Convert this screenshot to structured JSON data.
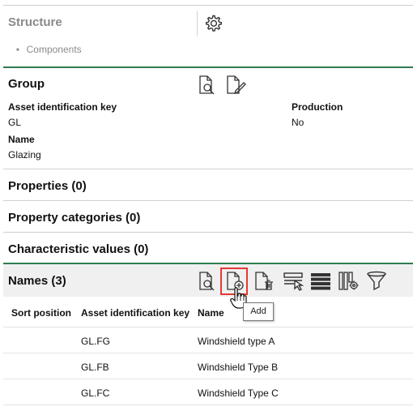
{
  "structure": {
    "title": "Structure",
    "settings_icon": "gear-icon",
    "items": [
      "Components"
    ]
  },
  "group": {
    "title": "Group",
    "icons": [
      "document-preview-icon",
      "document-edit-icon"
    ],
    "asset_key_label": "Asset identification key",
    "asset_key_value": "GL",
    "production_label": "Production",
    "production_value": "No",
    "name_label": "Name",
    "name_value": "Glazing"
  },
  "sections": {
    "properties": "Properties (0)",
    "property_categories": "Property categories (0)",
    "characteristic_values": "Characteristic values (0)"
  },
  "names": {
    "title": "Names (3)",
    "toolbar_icons": [
      "document-preview-icon",
      "document-add-icon",
      "document-delete-icon",
      "select-columns-icon",
      "row-density-icon",
      "column-settings-icon",
      "filter-icon"
    ],
    "highlighted_icon": "document-add-icon",
    "tooltip": "Add",
    "columns": [
      "Sort position",
      "Asset identification key",
      "Name"
    ],
    "rows": [
      {
        "sort_position": "",
        "asset_key": "GL.FG",
        "name": "Windshield type A"
      },
      {
        "sort_position": "",
        "asset_key": "GL.FB",
        "name": "Windshield Type B"
      },
      {
        "sort_position": "",
        "asset_key": "GL.FC",
        "name": "Windshield Type C"
      }
    ]
  },
  "colors": {
    "accent_green": "#2e7d4f",
    "highlight_red": "#e53935",
    "header_bg": "#f0f0f0"
  }
}
